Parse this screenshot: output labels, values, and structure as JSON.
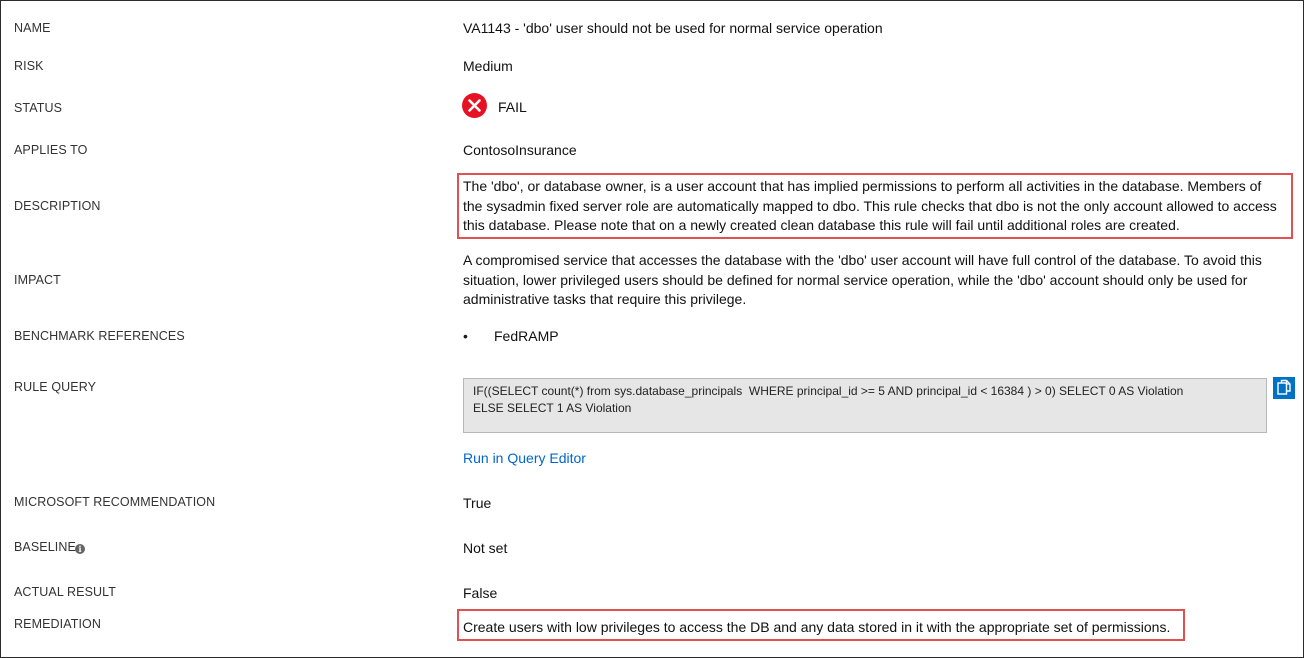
{
  "rows": {
    "name": {
      "label": "NAME",
      "value": "VA1143 - 'dbo' user should not be used for normal service operation"
    },
    "risk": {
      "label": "RISK",
      "value": "Medium"
    },
    "status": {
      "label": "STATUS",
      "value": "FAIL",
      "icon": "error-circle-icon",
      "color": "#e81123"
    },
    "applies_to": {
      "label": "APPLIES TO",
      "value": "ContosoInsurance"
    },
    "description": {
      "label": "DESCRIPTION",
      "value": "The 'dbo', or database owner, is a user account that has implied permissions to perform all activities in the database. Members of the sysadmin fixed server role are automatically mapped to dbo. This rule checks that dbo is not the only account allowed to access this database. Please note that on a newly created clean database this rule will fail until additional roles are created."
    },
    "impact": {
      "label": "IMPACT",
      "value": "A compromised service that accesses the database with the 'dbo' user account will have full control of the database. To avoid this situation, lower privileged users should be defined for normal service operation, while the 'dbo' account should only be used for administrative tasks that require this privilege."
    },
    "benchmark": {
      "label": "BENCHMARK REFERENCES",
      "bullet": "•",
      "items": [
        "FedRAMP"
      ]
    },
    "rule_query": {
      "label": "RULE QUERY",
      "query_lines": [
        "IF((SELECT count(*) from sys.database_principals  WHERE principal_id >= 5 AND principal_id < 16384 ) > 0) SELECT 0 AS Violation",
        "ELSE SELECT 1 AS Violation"
      ],
      "copy_icon": "copy-icon",
      "link": "Run in Query Editor"
    },
    "recommendation": {
      "label": "MICROSOFT RECOMMENDATION",
      "value": "True"
    },
    "baseline": {
      "label": "BASELINE",
      "value": "Not set",
      "info_icon": "info-icon",
      "info_glyph": "i"
    },
    "actual_result": {
      "label": "ACTUAL RESULT",
      "value": "False"
    },
    "remediation": {
      "label": "REMEDIATION",
      "value": "Create users with low privileges to access the DB and any data stored in it with the appropriate set of permissions."
    }
  },
  "colors": {
    "highlight": "#e05252",
    "link": "#0066cc",
    "copy_button": "#0072c6"
  }
}
